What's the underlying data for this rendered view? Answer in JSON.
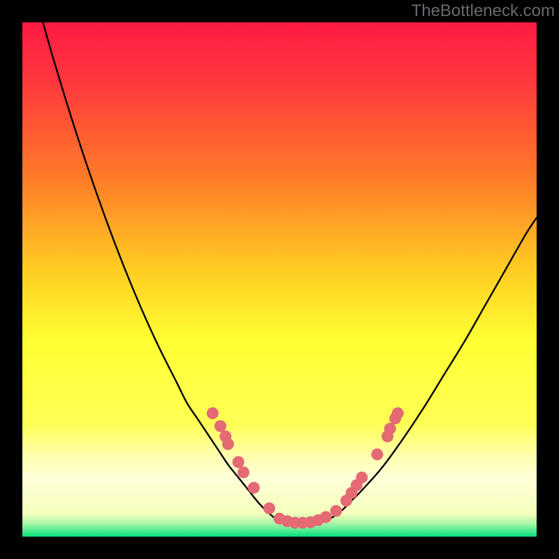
{
  "watermark": "TheBottleneck.com",
  "colors": {
    "frame": "#000000",
    "gradient_top": "#ff1a44",
    "gradient_mid_top": "#ff8a1f",
    "gradient_mid": "#ffff33",
    "gradient_band": "#ffffaa",
    "gradient_bottom": "#00e17a",
    "curve": "#000000",
    "marker_fill": "#e46a74",
    "marker_stroke": "#c94f5a"
  },
  "chart_data": {
    "type": "line",
    "title": "",
    "xlabel": "",
    "ylabel": "",
    "xlim": [
      0,
      100
    ],
    "ylim": [
      0,
      100
    ],
    "series": [
      {
        "name": "curve-left",
        "x": [
          4,
          6,
          10,
          14,
          18,
          22,
          26,
          30,
          32,
          34,
          36,
          38,
          40,
          42,
          44,
          46,
          48,
          50
        ],
        "y": [
          100,
          93,
          80,
          68,
          57,
          47,
          38,
          30,
          26,
          23,
          20,
          17,
          14,
          11.5,
          9,
          6.5,
          4.5,
          3
        ]
      },
      {
        "name": "curve-floor",
        "x": [
          50,
          52,
          54,
          56,
          58,
          60
        ],
        "y": [
          3,
          2.5,
          2.4,
          2.5,
          3,
          3.6
        ]
      },
      {
        "name": "curve-right",
        "x": [
          60,
          62,
          64,
          66,
          70,
          74,
          78,
          82,
          86,
          90,
          94,
          98,
          100
        ],
        "y": [
          3.6,
          5,
          7,
          9,
          13.5,
          19,
          25,
          31.5,
          38,
          45,
          52,
          59,
          62
        ]
      }
    ],
    "markers": [
      {
        "x": 37,
        "y": 24
      },
      {
        "x": 38.5,
        "y": 21.5
      },
      {
        "x": 39.5,
        "y": 19.5
      },
      {
        "x": 40,
        "y": 18
      },
      {
        "x": 42,
        "y": 14.5
      },
      {
        "x": 43,
        "y": 12.5
      },
      {
        "x": 45,
        "y": 9.5
      },
      {
        "x": 48,
        "y": 5.5
      },
      {
        "x": 50,
        "y": 3.5
      },
      {
        "x": 51.5,
        "y": 3
      },
      {
        "x": 53,
        "y": 2.7
      },
      {
        "x": 54.5,
        "y": 2.7
      },
      {
        "x": 56,
        "y": 2.8
      },
      {
        "x": 57.5,
        "y": 3.2
      },
      {
        "x": 59,
        "y": 3.8
      },
      {
        "x": 61,
        "y": 5
      },
      {
        "x": 63,
        "y": 7
      },
      {
        "x": 64,
        "y": 8.5
      },
      {
        "x": 65,
        "y": 10
      },
      {
        "x": 66,
        "y": 11.5
      },
      {
        "x": 69,
        "y": 16
      },
      {
        "x": 71,
        "y": 19.5
      },
      {
        "x": 71.5,
        "y": 21
      },
      {
        "x": 72.5,
        "y": 23
      },
      {
        "x": 73,
        "y": 24
      }
    ]
  }
}
